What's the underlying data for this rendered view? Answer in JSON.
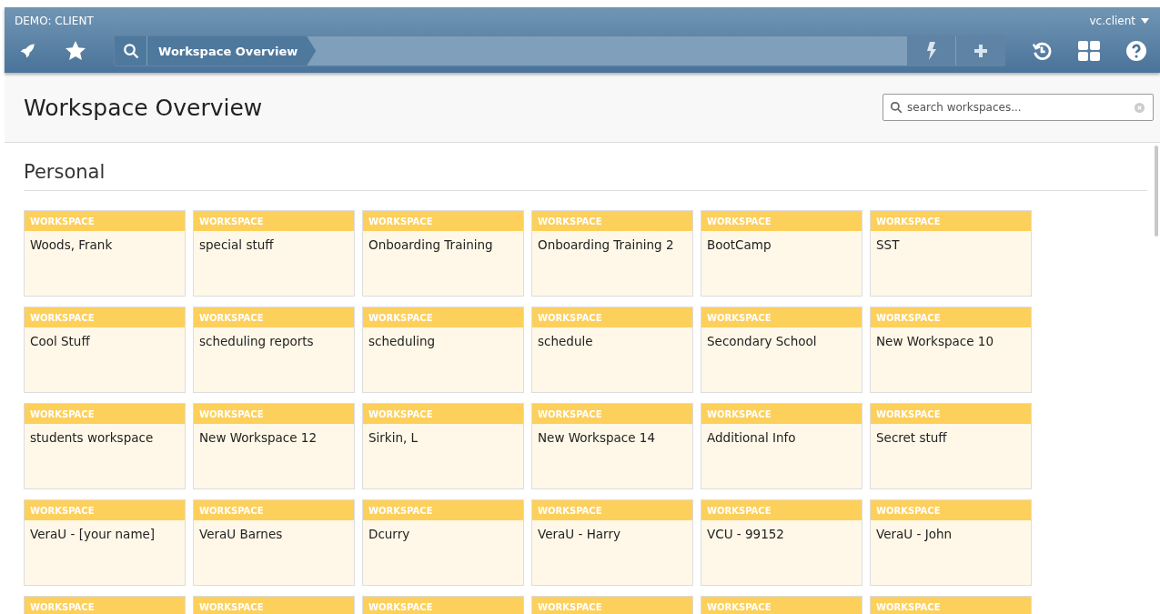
{
  "header": {
    "environment": "DEMO: CLIENT",
    "user": "vc.client",
    "breadcrumb": "Workspace Overview"
  },
  "page": {
    "title": "Workspace Overview",
    "search": {
      "placeholder": "search workspaces..."
    }
  },
  "section": {
    "title": "Personal",
    "cards": [
      {
        "label": "WORKSPACE",
        "title": "Woods, Frank"
      },
      {
        "label": "WORKSPACE",
        "title": "special stuff"
      },
      {
        "label": "WORKSPACE",
        "title": "Onboarding Training"
      },
      {
        "label": "WORKSPACE",
        "title": "Onboarding Training 2"
      },
      {
        "label": "WORKSPACE",
        "title": "BootCamp"
      },
      {
        "label": "WORKSPACE",
        "title": "SST"
      },
      {
        "label": "WORKSPACE",
        "title": "Cool Stuff"
      },
      {
        "label": "WORKSPACE",
        "title": "scheduling reports"
      },
      {
        "label": "WORKSPACE",
        "title": "scheduling"
      },
      {
        "label": "WORKSPACE",
        "title": "schedule"
      },
      {
        "label": "WORKSPACE",
        "title": "Secondary School"
      },
      {
        "label": "WORKSPACE",
        "title": "New Workspace 10"
      },
      {
        "label": "WORKSPACE",
        "title": "students workspace"
      },
      {
        "label": "WORKSPACE",
        "title": "New Workspace 12"
      },
      {
        "label": "WORKSPACE",
        "title": "Sirkin, L"
      },
      {
        "label": "WORKSPACE",
        "title": "New Workspace 14"
      },
      {
        "label": "WORKSPACE",
        "title": "Additional Info"
      },
      {
        "label": "WORKSPACE",
        "title": "Secret stuff"
      },
      {
        "label": "WORKSPACE",
        "title": "VeraU - [your name]"
      },
      {
        "label": "WORKSPACE",
        "title": "VeraU Barnes"
      },
      {
        "label": "WORKSPACE",
        "title": "Dcurry"
      },
      {
        "label": "WORKSPACE",
        "title": "VeraU - Harry"
      },
      {
        "label": "WORKSPACE",
        "title": "VCU - 99152"
      },
      {
        "label": "WORKSPACE",
        "title": "VeraU - John"
      },
      {
        "label": "WORKSPACE"
      },
      {
        "label": "WORKSPACE"
      },
      {
        "label": "WORKSPACE"
      },
      {
        "label": "WORKSPACE"
      },
      {
        "label": "WORKSPACE"
      },
      {
        "label": "WORKSPACE"
      }
    ]
  }
}
